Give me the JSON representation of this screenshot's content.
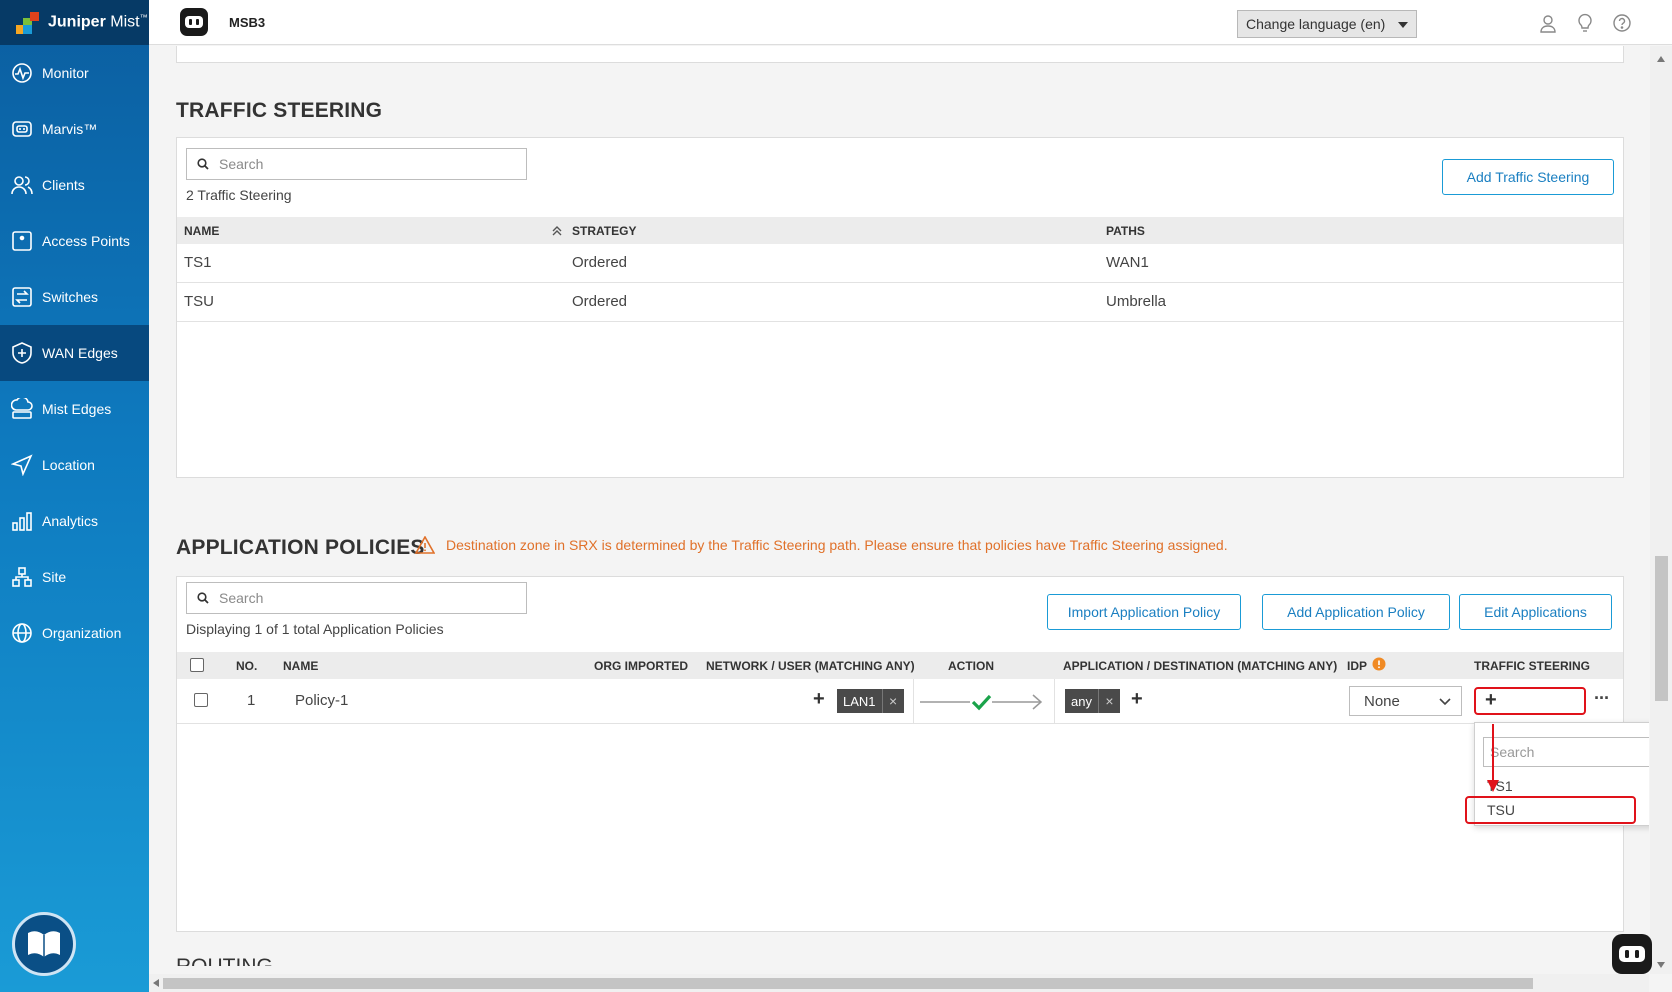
{
  "brand": {
    "name": "Juniper",
    "suffix": "Mist",
    "tm": "™"
  },
  "nav": [
    {
      "label": "Monitor",
      "icon": "monitor-icon"
    },
    {
      "label": "Marvis™",
      "icon": "marvis-icon"
    },
    {
      "label": "Clients",
      "icon": "clients-icon"
    },
    {
      "label": "Access Points",
      "icon": "access-points-icon"
    },
    {
      "label": "Switches",
      "icon": "switches-icon"
    },
    {
      "label": "WAN Edges",
      "icon": "wan-edges-icon",
      "active": true
    },
    {
      "label": "Mist Edges",
      "icon": "mist-edges-icon"
    },
    {
      "label": "Location",
      "icon": "location-icon"
    },
    {
      "label": "Analytics",
      "icon": "analytics-icon"
    },
    {
      "label": "Site",
      "icon": "site-icon"
    },
    {
      "label": "Organization",
      "icon": "organization-icon"
    }
  ],
  "topbar": {
    "site": "MSB3",
    "language": "Change language (en)"
  },
  "traffic_steering": {
    "title": "TRAFFIC STEERING",
    "search_placeholder": "Search",
    "count": "2 Traffic Steering",
    "add_button": "Add Traffic Steering",
    "columns": [
      "NAME",
      "STRATEGY",
      "PATHS"
    ],
    "rows": [
      {
        "name": "TS1",
        "strategy": "Ordered",
        "paths": "WAN1"
      },
      {
        "name": "TSU",
        "strategy": "Ordered",
        "paths": "Umbrella"
      }
    ]
  },
  "app_policies": {
    "title": "APPLICATION POLICIES",
    "warning": "Destination zone in SRX is determined by the Traffic Steering path. Please ensure that policies have Traffic Steering assigned.",
    "search_placeholder": "Search",
    "count": "Displaying 1 of 1 total Application Policies",
    "buttons": {
      "import": "Import Application Policy",
      "add": "Add Application Policy",
      "edit": "Edit Applications"
    },
    "columns": {
      "no": "NO.",
      "name": "NAME",
      "org_imported": "ORG IMPORTED",
      "network": "NETWORK / USER (MATCHING ANY)",
      "action": "ACTION",
      "application": "APPLICATION / DESTINATION (MATCHING ANY)",
      "idp": "IDP",
      "traffic_steering": "TRAFFIC STEERING"
    },
    "row": {
      "no": "1",
      "name": "Policy-1",
      "network_chip": "LAN1",
      "app_chip": "any",
      "idp": "None"
    },
    "dropdown": {
      "search_placeholder": "Search",
      "options": [
        "TS1",
        "TSU"
      ]
    }
  },
  "next_section_partial": "ROUTING",
  "colors": {
    "accent": "#1a9bd6",
    "highlight": "#e0121a",
    "warning": "#e0712a",
    "action_check": "#1aa34a"
  }
}
